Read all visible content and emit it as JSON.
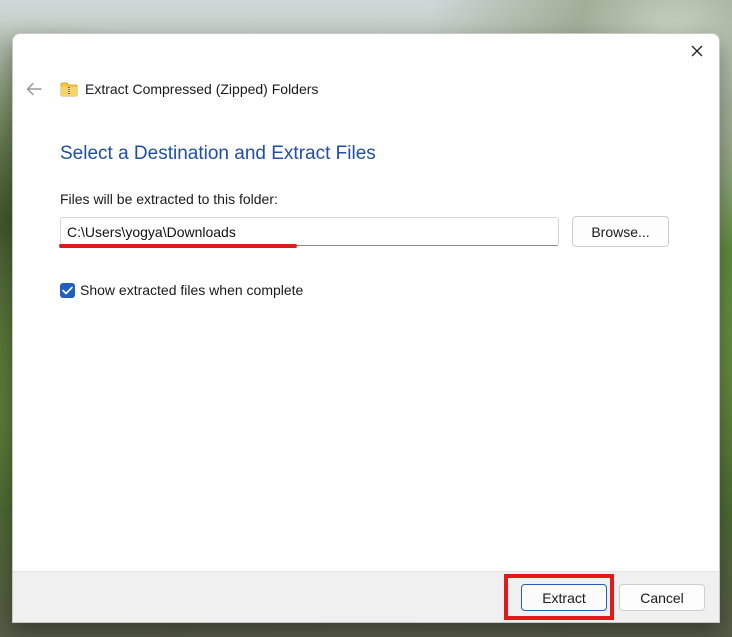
{
  "window": {
    "title": "Extract Compressed (Zipped) Folders",
    "close_icon": "close-icon",
    "back_icon": "back-arrow-icon",
    "folder_icon": "zipped-folder-icon"
  },
  "main": {
    "heading": "Select a Destination and Extract Files",
    "destination_label": "Files will be extracted to this folder:",
    "destination_path": "C:\\Users\\yogya\\Downloads",
    "browse_label": "Browse...",
    "show_files_label": "Show extracted files when complete",
    "show_files_checked": true
  },
  "footer": {
    "extract_label": "Extract",
    "cancel_label": "Cancel"
  },
  "colors": {
    "accent": "#1f5fbf",
    "heading": "#1f4fa4",
    "highlight": "#e31919"
  }
}
